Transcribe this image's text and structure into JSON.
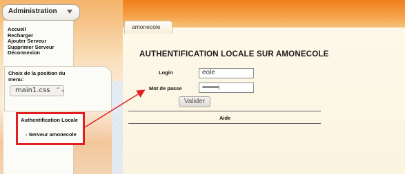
{
  "menu": {
    "admin_label": "Administration",
    "links": [
      "Accueil",
      "Recharger",
      "Ajouter Serveur",
      "Supprimer Serveur",
      "Déconnexion"
    ]
  },
  "position_panel": {
    "title": "Choix de la position du menu:",
    "css_value": "main1.css",
    "spinner": "⌃⌄"
  },
  "auth_menu": {
    "title": "Authentification Locale",
    "server_item": "- Serveur amonecole"
  },
  "tab": {
    "label": "amonecole"
  },
  "form": {
    "heading": "AUTHENTIFICATION LOCALE SUR AMONECOLE",
    "login_label": "Login",
    "login_value": "eole",
    "password_label": "Mot de passe",
    "password_value": "••••••••••••••••|",
    "submit_label": "Valider"
  },
  "help": {
    "label": "Aide"
  },
  "colors": {
    "accent_orange": "#f07f1c",
    "annotation_red": "#e02020"
  }
}
